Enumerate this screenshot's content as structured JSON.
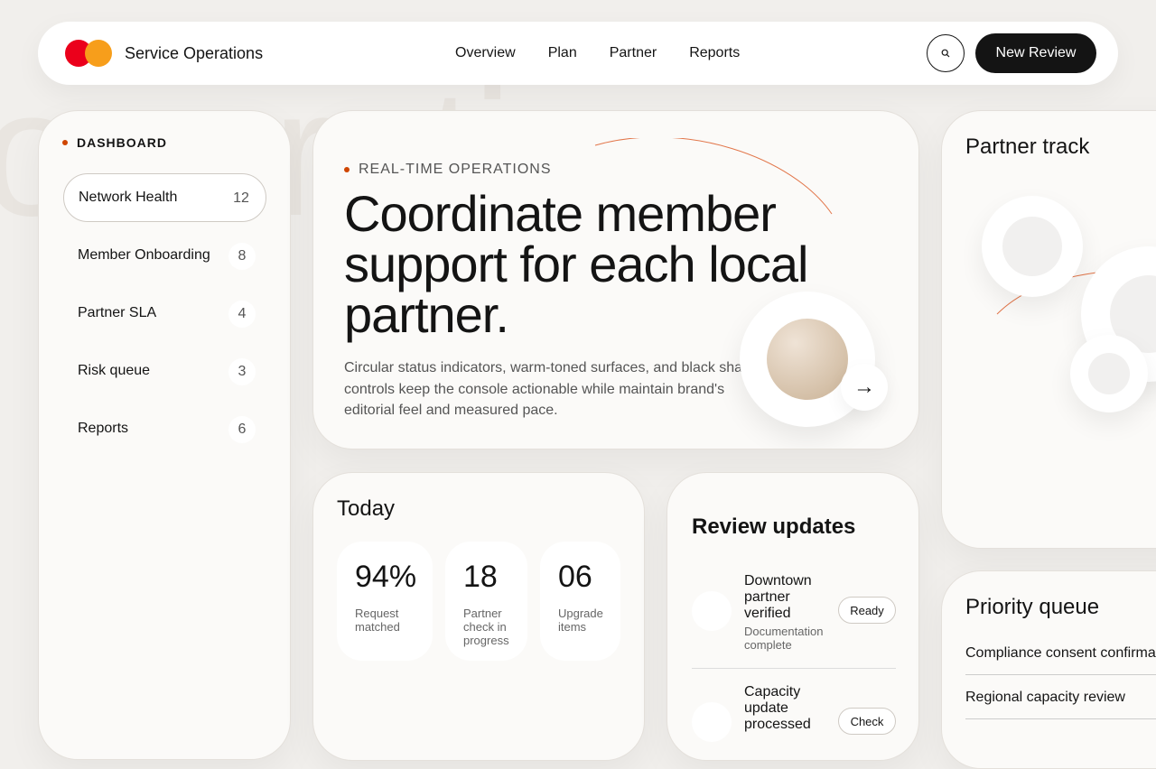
{
  "watermark": "operati",
  "header": {
    "brand": "Service Operations",
    "nav": [
      "Overview",
      "Plan",
      "Partner",
      "Reports"
    ],
    "primary_action": "New Review",
    "colors": {
      "logo_red": "#eb001b",
      "logo_orange": "#f79e1b",
      "accent": "#cf4500"
    }
  },
  "sidebar": {
    "heading": "DASHBOARD",
    "items": [
      {
        "label": "Network Health",
        "count": "12"
      },
      {
        "label": "Member Onboarding",
        "count": "8"
      },
      {
        "label": "Partner SLA",
        "count": "4"
      },
      {
        "label": "Risk queue",
        "count": "3"
      },
      {
        "label": "Reports",
        "count": "6"
      }
    ]
  },
  "hero": {
    "eyebrow": "REAL-TIME OPERATIONS",
    "title": "Coordinate member support for each local partner.",
    "body": "Circular status indicators, warm-toned surfaces, and black shaped controls keep the console actionable while maintain brand's editorial feel and measured pace.",
    "arrow": "→"
  },
  "today": {
    "title": "Today",
    "stats": [
      {
        "value": "94%",
        "caption": "Request matched"
      },
      {
        "value": "18",
        "caption": "Partner check in progress"
      },
      {
        "value": "06",
        "caption": "Upgrade items"
      }
    ]
  },
  "updates": {
    "title": "Review updates",
    "items": [
      {
        "title": "Downtown partner verified",
        "subtitle": "Documentation complete",
        "status": "Ready"
      },
      {
        "title": "Capacity update processed",
        "subtitle": "",
        "status": "Check"
      }
    ]
  },
  "track": {
    "title": "Partner track"
  },
  "priority": {
    "title": "Priority queue",
    "items": [
      "Compliance consent confirmation",
      "Regional capacity review"
    ]
  }
}
